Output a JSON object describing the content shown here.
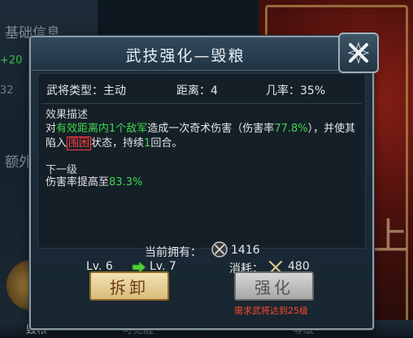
{
  "background": {
    "left_title": "基础信息",
    "left_num1": "+20",
    "left_num2": "32",
    "left_extra": "额外",
    "right_big_char": "上",
    "bottom_items": [
      "毁粮",
      "可觉醒",
      "等级"
    ]
  },
  "dialog": {
    "title": "武技强化—毁粮",
    "close_icon": "close-x-icon",
    "stats": {
      "type_label": "武将类型：主动",
      "distance_label": "距离：4",
      "chance_label": "几率：35%"
    },
    "effect_heading": "效果描述",
    "effect_text": {
      "p1": "对",
      "p2": "有效距离内1个敌军",
      "p3": "造成一次奇术伤害（伤害率",
      "p4": "77.8%",
      "p5": "），并使其陷入",
      "p6": "围困",
      "p7": "状态，持续",
      "p8": "1",
      "p9": "回合。"
    },
    "next_level_heading": "下一级",
    "next_level_text": {
      "p1": "伤害率提高至",
      "p2": "83.3%"
    },
    "level_current": "Lv. 6",
    "level_next": "Lv. 7",
    "cost_label": "消耗：",
    "cost_value": "480",
    "owned_label": "当前拥有：",
    "owned_value": "1416",
    "dismantle_label": "拆卸",
    "strengthen_label": "强化",
    "requirement_text": "需求武将达到25级"
  },
  "colors": {
    "accent_green": "#3ed84a",
    "warning_red": "#ff3b3b",
    "gold": "#d8bc7a"
  }
}
